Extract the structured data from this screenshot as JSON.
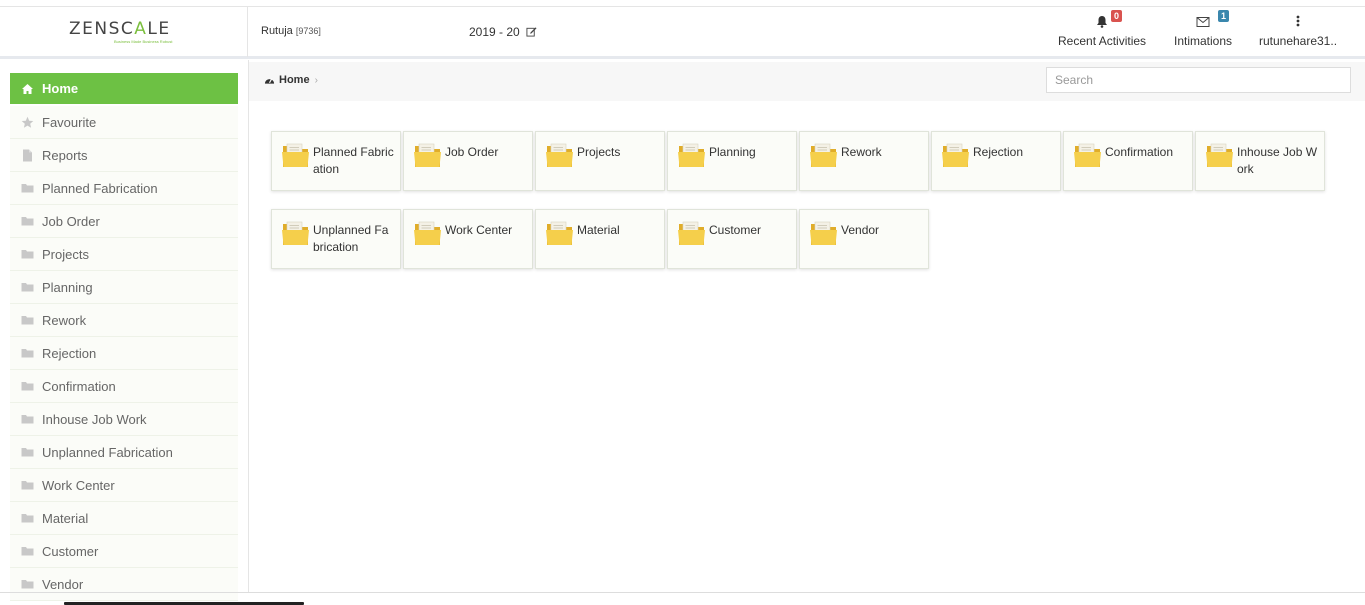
{
  "header": {
    "logo_prefix": "ZENSC",
    "logo_accent": "A",
    "logo_suffix": "LE",
    "tagline": "Business Made Business Robust",
    "user_name": "Rutuja",
    "user_id": "[9736]",
    "fiscal_year": "2019 - 20",
    "notifications": [
      {
        "label": "Recent Activities",
        "icon": "bell-icon",
        "count": "0",
        "badge_color": "#d9534f"
      },
      {
        "label": "Intimations",
        "icon": "envelope-icon",
        "count": "1",
        "badge_color": "#3a87ad"
      }
    ],
    "account_label": "rutunehare31.."
  },
  "breadcrumb": {
    "label": "Home",
    "icon": "dashboard-icon"
  },
  "search": {
    "placeholder": "Search"
  },
  "sidebar": {
    "accent_color": "#6dc144",
    "items": [
      {
        "label": "Home",
        "icon": "home-icon",
        "active": true
      },
      {
        "label": "Favourite",
        "icon": "star-icon"
      },
      {
        "label": "Reports",
        "icon": "document-icon"
      },
      {
        "label": "Planned Fabrication",
        "icon": "folder-icon"
      },
      {
        "label": "Job Order",
        "icon": "folder-icon"
      },
      {
        "label": "Projects",
        "icon": "folder-icon"
      },
      {
        "label": "Planning",
        "icon": "folder-icon"
      },
      {
        "label": "Rework",
        "icon": "folder-icon"
      },
      {
        "label": "Rejection",
        "icon": "folder-icon"
      },
      {
        "label": "Confirmation",
        "icon": "folder-icon"
      },
      {
        "label": "Inhouse Job Work",
        "icon": "folder-icon"
      },
      {
        "label": "Unplanned Fabrication",
        "icon": "folder-icon"
      },
      {
        "label": "Work Center",
        "icon": "folder-icon"
      },
      {
        "label": "Material",
        "icon": "folder-icon"
      },
      {
        "label": "Customer",
        "icon": "folder-icon"
      },
      {
        "label": "Vendor",
        "icon": "folder-icon"
      }
    ]
  },
  "tiles": [
    {
      "label": "Planned Fabrication"
    },
    {
      "label": "Job Order"
    },
    {
      "label": "Projects"
    },
    {
      "label": "Planning"
    },
    {
      "label": "Rework"
    },
    {
      "label": "Rejection"
    },
    {
      "label": "Confirmation"
    },
    {
      "label": "Inhouse Job Work"
    },
    {
      "label": "Unplanned Fabrication"
    },
    {
      "label": "Work Center"
    },
    {
      "label": "Material"
    },
    {
      "label": "Customer"
    },
    {
      "label": "Vendor"
    }
  ]
}
